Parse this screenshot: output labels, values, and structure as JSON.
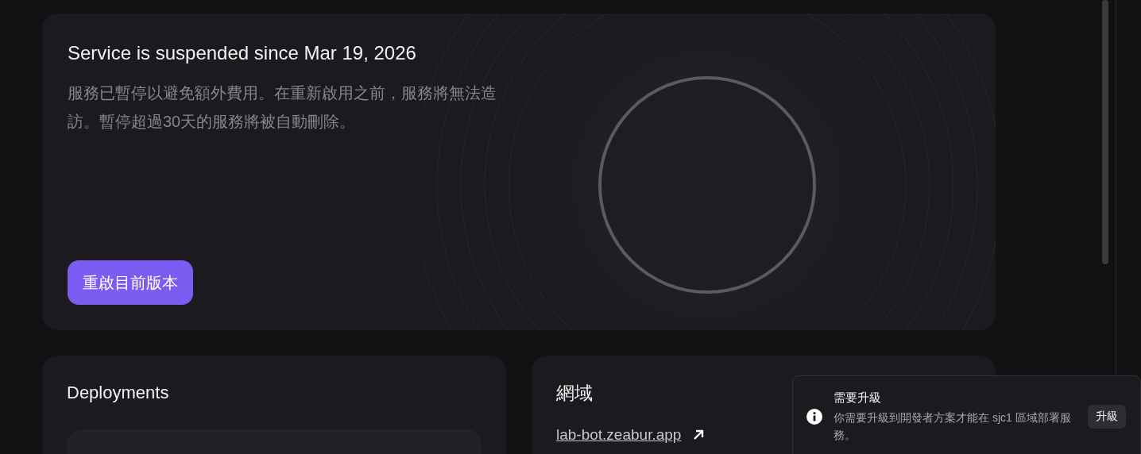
{
  "banner": {
    "title": "Service is suspended since Mar 19, 2026",
    "description": "服務已暫停以避免額外費用。在重新啟用之前，服務將無法造訪。暫停超過30天的服務將被自動刪除。",
    "button": "重啟目前版本"
  },
  "deployments": {
    "title": "Deployments"
  },
  "domains": {
    "title": "網域",
    "link": "lab-bot.zeabur.app"
  },
  "toast": {
    "title": "需要升級",
    "message": "你需要升級到開發者方案才能在 sjc1 區域部署服務。",
    "button": "升級"
  }
}
